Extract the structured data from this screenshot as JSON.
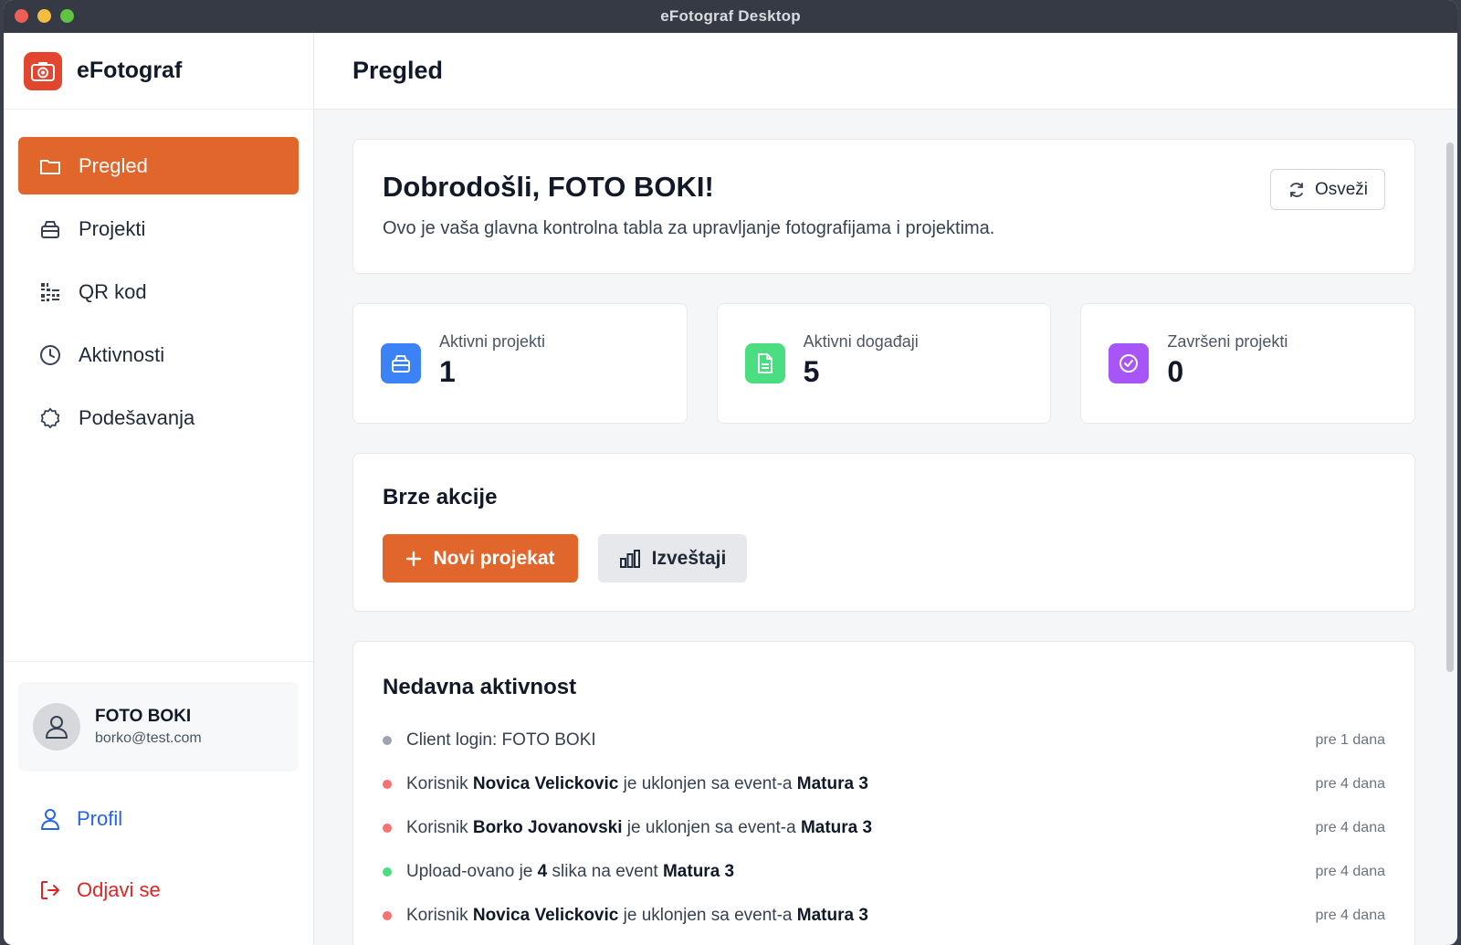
{
  "window": {
    "title": "eFotograf Desktop"
  },
  "sidebar": {
    "brand": "eFotograf",
    "items": [
      {
        "label": "Pregled",
        "icon": "folder-icon",
        "active": true
      },
      {
        "label": "Projekti",
        "icon": "box-icon",
        "active": false
      },
      {
        "label": "QR kod",
        "icon": "qr-code-icon",
        "active": false
      },
      {
        "label": "Aktivnosti",
        "icon": "clock-icon",
        "active": false
      },
      {
        "label": "Podešavanja",
        "icon": "gear-icon",
        "active": false
      }
    ],
    "user": {
      "name": "FOTO BOKI",
      "email": "borko@test.com"
    },
    "profile_label": "Profil",
    "logout_label": "Odjavi se"
  },
  "header": {
    "title": "Pregled"
  },
  "welcome": {
    "title": "Dobrodošli, FOTO BOKI!",
    "subtitle": "Ovo je vaša glavna kontrolna tabla za upravljanje fotografijama i projektima.",
    "refresh_label": "Osveži"
  },
  "stats": [
    {
      "label": "Aktivni projekti",
      "value": "1",
      "color": "#3b82f6",
      "icon": "box-icon"
    },
    {
      "label": "Aktivni događaji",
      "value": "5",
      "color": "#4ade80",
      "icon": "document-icon"
    },
    {
      "label": "Završeni projekti",
      "value": "0",
      "color": "#a855f7",
      "icon": "check-circle-icon"
    }
  ],
  "quick_actions": {
    "title": "Brze akcije",
    "new_project_label": "Novi projekat",
    "reports_label": "Izveštaji"
  },
  "recent_activity": {
    "title": "Nedavna aktivnost",
    "items": [
      {
        "parts": [
          {
            "t": "Client login: FOTO BOKI",
            "b": false
          }
        ],
        "time": "pre 1 dana",
        "color": "#9ca3af"
      },
      {
        "parts": [
          {
            "t": "Korisnik ",
            "b": false
          },
          {
            "t": "Novica Velickovic",
            "b": true
          },
          {
            "t": " je uklonjen sa event-a ",
            "b": false
          },
          {
            "t": "Matura 3",
            "b": true
          }
        ],
        "time": "pre 4 dana",
        "color": "#f87171"
      },
      {
        "parts": [
          {
            "t": "Korisnik ",
            "b": false
          },
          {
            "t": "Borko Jovanovski",
            "b": true
          },
          {
            "t": " je uklonjen sa event-a ",
            "b": false
          },
          {
            "t": "Matura 3",
            "b": true
          }
        ],
        "time": "pre 4 dana",
        "color": "#f87171"
      },
      {
        "parts": [
          {
            "t": "Upload-ovano je ",
            "b": false
          },
          {
            "t": "4",
            "b": true
          },
          {
            "t": " slika na event ",
            "b": false
          },
          {
            "t": "Matura 3",
            "b": true
          }
        ],
        "time": "pre 4 dana",
        "color": "#4ade80"
      },
      {
        "parts": [
          {
            "t": "Korisnik ",
            "b": false
          },
          {
            "t": "Novica Velickovic",
            "b": true
          },
          {
            "t": " je uklonjen sa event-a ",
            "b": false
          },
          {
            "t": "Matura 3",
            "b": true
          }
        ],
        "time": "pre 4 dana",
        "color": "#f87171"
      }
    ]
  },
  "colors": {
    "accent": "#e0662b",
    "brand_logo": "#e2462e",
    "profile": "#2563eb",
    "logout": "#dc2626"
  }
}
